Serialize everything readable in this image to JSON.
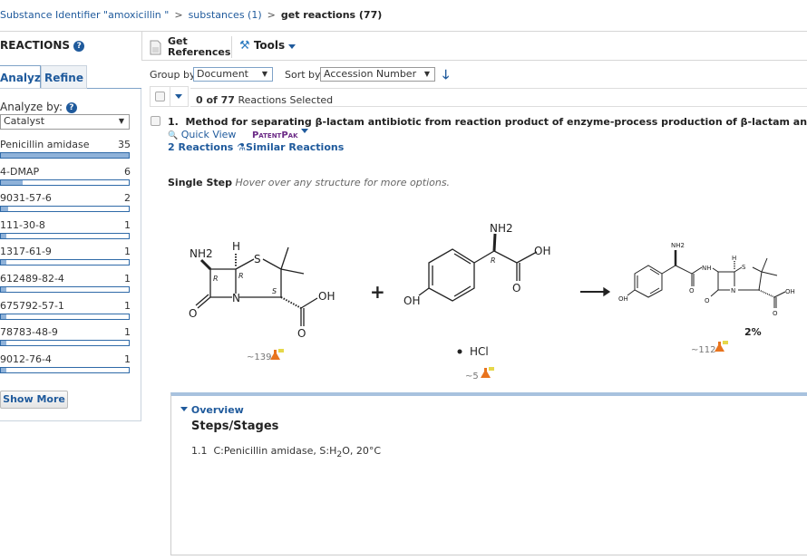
{
  "breadcrumb": {
    "items": [
      "Substance Identifier \"amoxicillin \"",
      "substances (1)"
    ],
    "current": "get reactions (77)",
    "separator": ">"
  },
  "sidebar": {
    "title": "REACTIONS",
    "tabs": [
      {
        "label": "Analyze",
        "active": true
      },
      {
        "label": "Refine",
        "active": false
      }
    ],
    "analyze_by_label": "Analyze by:",
    "analyze_by_value": "Catalyst",
    "items": [
      {
        "label": "Penicillin amidase",
        "count": 35
      },
      {
        "label": "4-DMAP",
        "count": 6
      },
      {
        "label": "9031-57-6",
        "count": 2
      },
      {
        "label": "111-30-8",
        "count": 1
      },
      {
        "label": "1317-61-9",
        "count": 1
      },
      {
        "label": "612489-82-4",
        "count": 1
      },
      {
        "label": "675792-57-1",
        "count": 1
      },
      {
        "label": "78783-48-9",
        "count": 1
      },
      {
        "label": "9012-76-4",
        "count": 1
      }
    ],
    "show_more": "Show More"
  },
  "toolbar": {
    "get_references_line1": "Get",
    "get_references_line2": "References",
    "tools": "Tools"
  },
  "controls": {
    "group_by_label": "Group by:",
    "group_by_value": "Document",
    "sort_by_label": "Sort by:",
    "sort_by_value": "Accession Number"
  },
  "selection": {
    "count": "0 of 77",
    "suffix": "Reactions Selected"
  },
  "result": {
    "number": "1.",
    "title": "Method for separating β-lactam antibiotic from reaction product of enzyme-process production of β-lactam antibiotic",
    "quick_view": "Quick View",
    "patentpak": "PatentPak",
    "reactions_link": "2 Reactions",
    "similar_link": "Similar Reactions",
    "step_label": "Single Step",
    "step_hint": "Hover over any structure for more options."
  },
  "scheme": {
    "reactant1": {
      "nh2": "NH2",
      "h": "H",
      "s": "S",
      "n": "N",
      "o1": "O",
      "oh": "OH",
      "o2": "O",
      "r1": "R",
      "r2": "R",
      "s_stereo": "S",
      "refs": "~139"
    },
    "plus": "+",
    "reactant2": {
      "nh2": "NH2",
      "oh_ring": "OH",
      "oh": "OH",
      "o": "O",
      "r": "R",
      "salt": "HCl",
      "refs": "~5"
    },
    "product": {
      "nh2": "NH2",
      "oh_ring": "OH",
      "nh": "NH",
      "o1": "O",
      "h": "H",
      "s": "S",
      "n": "N",
      "o2": "O",
      "oh": "OH",
      "o3": "O",
      "yield": "2%",
      "refs": "~112"
    }
  },
  "overview": {
    "toggle": "Overview",
    "heading": "Steps/Stages",
    "steps": [
      {
        "num": "1.1",
        "text": "C:Penicillin amidase, S:H",
        "sub": "2",
        "text2": "O, 20°C"
      }
    ]
  },
  "colors": {
    "link": "#1f5a9c",
    "bar_fill": "#8fb2d9",
    "bar_border": "#2f6aa8",
    "patentpak": "#6b2a86",
    "flask": "#e8741e"
  }
}
